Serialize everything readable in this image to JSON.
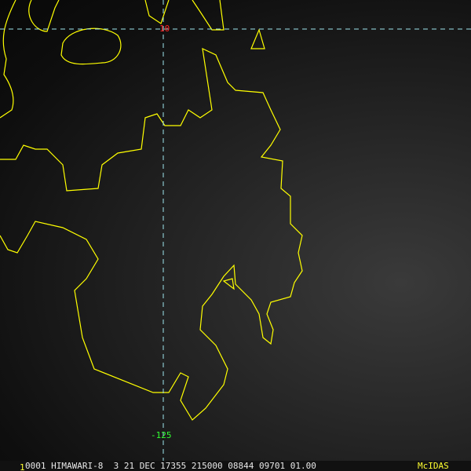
{
  "overlay": {
    "lat_label": "10",
    "lon_label": "-125"
  },
  "status_bar": {
    "frame_number": "1",
    "text": "0001 HIMAWARI-8  3 21 DEC 17355 215000 08844 09701 01.00",
    "brand": "McIDAS"
  },
  "colors": {
    "coastline": "#ffff00",
    "grid": "#9ee6ee",
    "lat_label": "#ff2020",
    "lon_label": "#30ff30",
    "brand": "#ffff30"
  }
}
